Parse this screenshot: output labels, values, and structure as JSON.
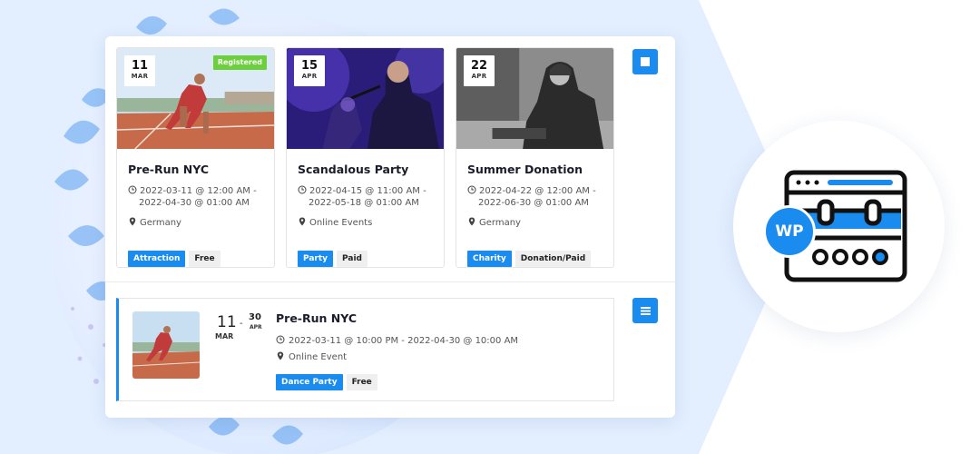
{
  "colors": {
    "accent": "#1a8cf0",
    "registered": "#6ccf3c",
    "background": "#e3efff"
  },
  "grid_cards": [
    {
      "day": "11",
      "month": "MAR",
      "badge": "Registered",
      "title": "Pre-Run NYC",
      "date_line1": "2022-03-11 @ 12:00 AM -",
      "date_line2": "2022-04-30 @ 01:00 AM",
      "location": "Germany",
      "category": "Attraction",
      "price": "Free",
      "image": "runner-on-track"
    },
    {
      "day": "15",
      "month": "APR",
      "title": "Scandalous Party",
      "date_line1": "2022-04-15 @ 11:00 AM -",
      "date_line2": "2022-05-18 @ 01:00 AM",
      "location": "Online Events",
      "category": "Party",
      "price": "Paid",
      "image": "concert-singer"
    },
    {
      "day": "22",
      "month": "APR",
      "title": "Summer Donation",
      "date_line1": "2022-04-22 @ 12:00 AM -",
      "date_line2": "2022-06-30 @ 01:00 AM",
      "location": "Germany",
      "category": "Charity",
      "price": "Donation/Paid",
      "image": "elderly-man-bw"
    }
  ],
  "list_event": {
    "start_day": "11",
    "start_month": "MAR",
    "separator": "-",
    "end_day": "30",
    "end_month": "APR",
    "title": "Pre-Run NYC",
    "datetime": "2022-03-11 @ 10:00 PM - 2022-04-30 @ 10:00 AM",
    "location": "Online Event",
    "category": "Dance Party",
    "price": "Free",
    "image": "runner-on-track"
  },
  "view_buttons": {
    "grid_icon": "grid-view-icon",
    "list_icon": "list-view-icon"
  },
  "logo": {
    "text": "WP",
    "icon": "calendar-browser-icon"
  }
}
